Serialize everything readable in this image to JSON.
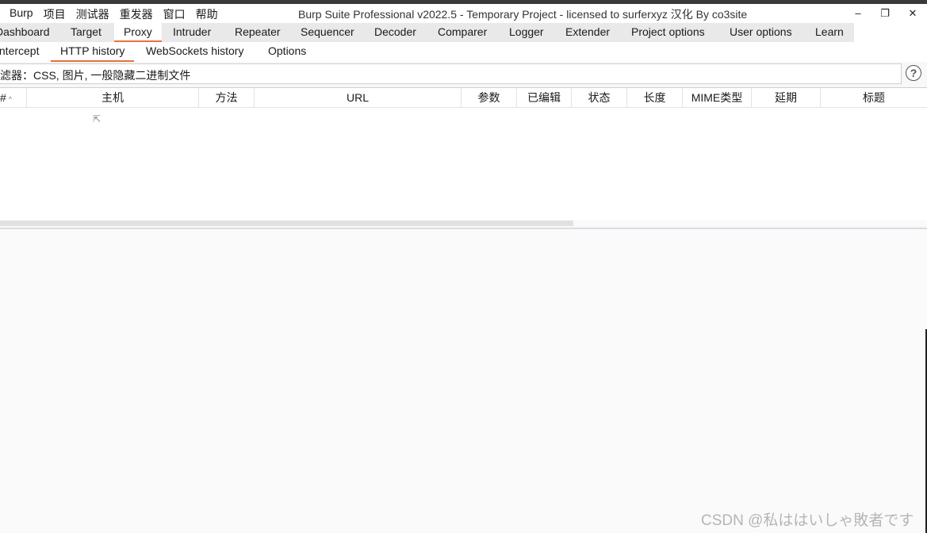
{
  "app": {
    "menu": [
      "Burp",
      "项目",
      "测试器",
      "重发器",
      "窗口",
      "帮助"
    ],
    "title": "Burp Suite Professional v2022.5 - Temporary Project - licensed to surferxyz 汉化 By co3site",
    "window_controls": {
      "minimize": "–",
      "restore": "❐",
      "close": "✕"
    }
  },
  "main_tabs": [
    "Dashboard",
    "Target",
    "Proxy",
    "Intruder",
    "Repeater",
    "Sequencer",
    "Decoder",
    "Comparer",
    "Logger",
    "Extender",
    "Project options",
    "User options",
    "Learn"
  ],
  "main_tabs_active": "Proxy",
  "proxy_tabs": [
    "Intercept",
    "HTTP history",
    "WebSockets history",
    "Options"
  ],
  "proxy_tabs_active": "HTTP history",
  "filter": {
    "text": "滤器：CSS, 图片, 一般隐藏二进制文件"
  },
  "help_icon": "?",
  "history_table": {
    "columns": [
      "#",
      "主机",
      "方法",
      "URL",
      "参数",
      "已编辑",
      "状态",
      "长度",
      "MIME类型",
      "延期",
      "标题"
    ],
    "sort_indicator": "^",
    "rows": []
  },
  "watermark": "CSDN @私ははいしゃ敗者です",
  "colors": {
    "accent": "#e8713b",
    "tab_bar": "#e9e9e9"
  }
}
